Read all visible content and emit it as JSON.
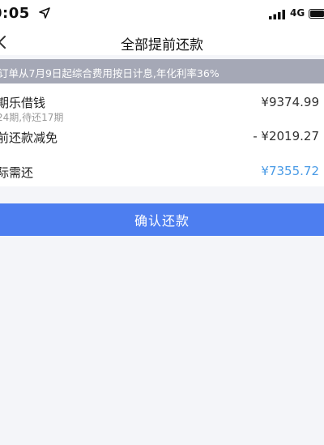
{
  "status_bar": {
    "time": "0:05",
    "network": "4G",
    "icons": [
      "location-arrow-icon",
      "signal-icon",
      "battery-icon"
    ]
  },
  "nav": {
    "title": "全部提前还款",
    "back_icon": "chevron-left-icon"
  },
  "notice": {
    "text": "订单从7月9日起综合费用按日计息,年化利率36%"
  },
  "rows": [
    {
      "label": "期乐借钱",
      "sub": "24期,待还17期",
      "amount": "¥9374.99"
    },
    {
      "label": "前还款减免",
      "amount": "- ¥2019.27"
    },
    {
      "label": "际需还",
      "amount": "¥7355.72"
    }
  ],
  "confirm_button": {
    "label": "确认还款"
  },
  "colors": {
    "accent": "#4d7ef0",
    "amount_highlight": "#4a9be6",
    "notice_bg": "#a5a8b6",
    "page_bg": "#f4f5f9"
  }
}
